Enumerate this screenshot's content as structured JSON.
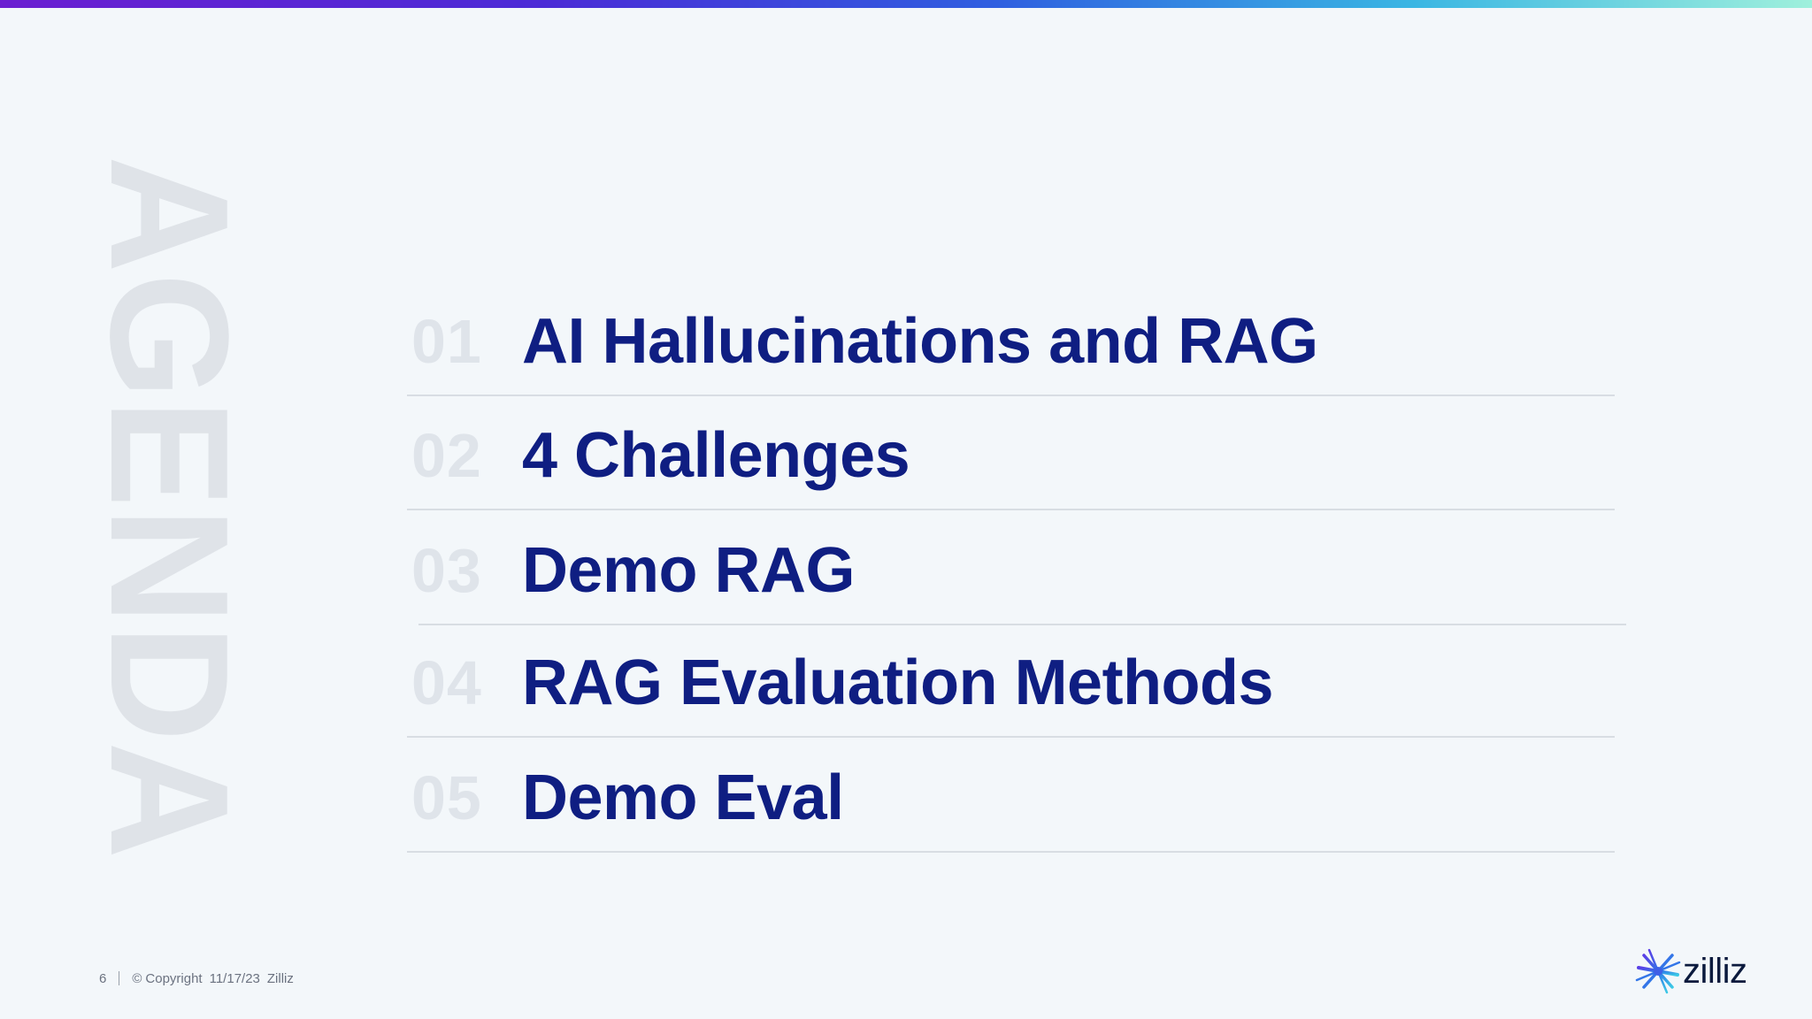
{
  "top_bar": {
    "gradient_colors": [
      "#6b1fd1",
      "#4b2bd6",
      "#2f5fe0",
      "#3ab6e3",
      "#9ff0dc"
    ]
  },
  "side_title": "AGENDA",
  "agenda": {
    "items": [
      {
        "number": "01",
        "title": "AI Hallucinations and RAG"
      },
      {
        "number": "02",
        "title": "4 Challenges"
      },
      {
        "number": "03",
        "title": "Demo RAG"
      },
      {
        "number": "04",
        "title": "RAG Evaluation Methods"
      },
      {
        "number": "05",
        "title": "Demo Eval"
      }
    ]
  },
  "footer": {
    "page_number": "6",
    "copyright": "Copyright",
    "date": "11/17/23",
    "company": "Zilliz"
  },
  "logo": {
    "text": "zilliz",
    "icon": "zilliz-star-icon"
  },
  "colors": {
    "background": "#f3f7fa",
    "title_text": "#0f1e82",
    "number_text": "#dfe4ea",
    "side_title": "#dfe3e8",
    "divider": "#d8dde3"
  }
}
